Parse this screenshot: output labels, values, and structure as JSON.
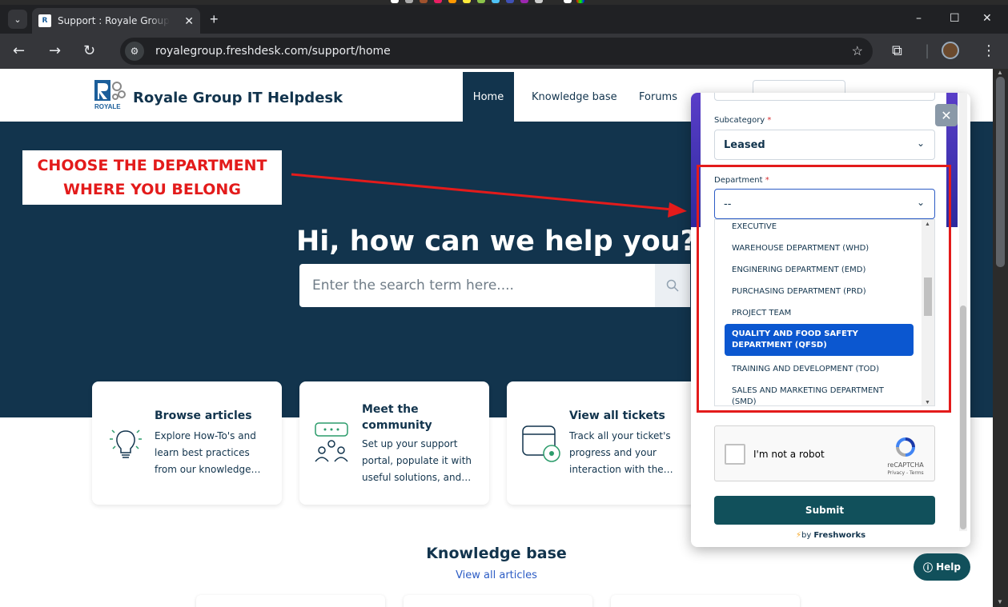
{
  "browser": {
    "tab": {
      "title": "Support : Royale Group IT Helpdesk",
      "favicon": "royale-favicon"
    },
    "url": "royalegroup.freshdesk.com/support/home"
  },
  "header": {
    "brand": "Royale Group IT Helpdesk",
    "logo_text": "ROYALE",
    "nav": {
      "home": "Home",
      "knowledge_base": "Knowledge base",
      "forums": "Forums"
    }
  },
  "hero": {
    "title": "Hi, how can we help you?",
    "search_placeholder": "Enter the search term here...."
  },
  "annotation": {
    "line1": "CHOOSE THE DEPARTMENT",
    "line2": "WHERE YOU BELONG"
  },
  "cards": [
    {
      "title": "Browse articles",
      "desc": "Explore How-To's and learn best practices from our knowledge…",
      "icon": "lightbulb-icon"
    },
    {
      "title": "Meet the community",
      "desc": "Set up your support portal, populate it with useful solutions, and…",
      "icon": "community-icon"
    },
    {
      "title": "View all tickets",
      "desc": "Track all your ticket's progress and your interaction with the…",
      "icon": "ticket-icon"
    }
  ],
  "knowledge_base": {
    "title": "Knowledge base",
    "link": "View all articles"
  },
  "widget": {
    "subcategory_label": "Subcategory",
    "subcategory_value": "Leased",
    "department_label": "Department",
    "department_value": "--",
    "options": [
      {
        "label": "EXECUTIVE",
        "selected": false
      },
      {
        "label": "WAREHOUSE DEPARTMENT (WHD)",
        "selected": false
      },
      {
        "label": "ENGINERING DEPARTMENT (EMD)",
        "selected": false
      },
      {
        "label": "PURCHASING DEPARTMENT (PRD)",
        "selected": false
      },
      {
        "label": "PROJECT TEAM",
        "selected": false
      },
      {
        "label": "QUALITY AND FOOD SAFETY DEPARTMENT (QFSD)",
        "selected": true
      },
      {
        "label": "TRAINING AND DEVELOPMENT (TOD)",
        "selected": false
      },
      {
        "label": "SALES AND MARKETING DEPARTMENT (SMD)",
        "selected": false
      }
    ],
    "recaptcha": {
      "label": "I'm not a robot",
      "brand": "reCAPTCHA",
      "terms": "Privacy - Terms"
    },
    "submit": "Submit",
    "footer_by": "by",
    "footer_brand": "Freshworks",
    "required_mark": "*"
  },
  "help_button": "Help",
  "colors": {
    "navy": "#12344d",
    "teal": "#11505b",
    "accent_red": "#e31b1b",
    "selected_blue": "#0b57d0"
  }
}
